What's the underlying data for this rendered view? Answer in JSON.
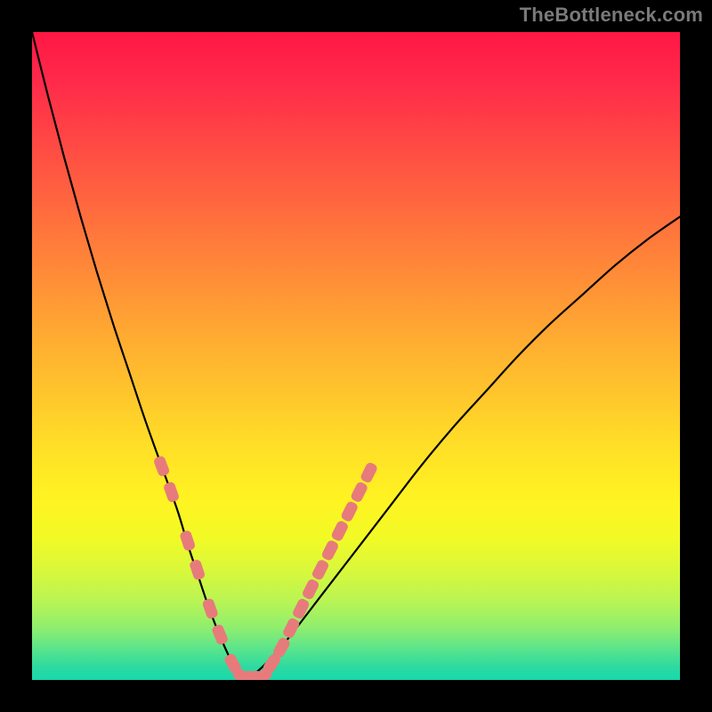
{
  "watermark": "TheBottleneck.com",
  "chart_data": {
    "type": "line",
    "title": "",
    "xlabel": "",
    "ylabel": "",
    "xlim": [
      0,
      100
    ],
    "ylim": [
      0,
      100
    ],
    "grid": false,
    "gradient_bands": [
      {
        "pos": 0,
        "color": "#ff1744",
        "meaning": "severe-bottleneck"
      },
      {
        "pos": 50,
        "color": "#ffd027",
        "meaning": "moderate"
      },
      {
        "pos": 100,
        "color": "#17d8ac",
        "meaning": "balanced"
      }
    ],
    "series": [
      {
        "name": "left-branch",
        "x": [
          0.0,
          2.5,
          5.0,
          7.5,
          10.0,
          12.5,
          15.0,
          17.5,
          20.0,
          22.5,
          24.0,
          25.5,
          27.0,
          28.5,
          30.0,
          31.0,
          32.0,
          33.0
        ],
        "y": [
          100.0,
          90.0,
          80.5,
          71.5,
          63.0,
          55.0,
          47.5,
          40.0,
          33.0,
          26.0,
          21.0,
          16.5,
          12.0,
          8.0,
          4.5,
          2.5,
          1.0,
          0.0
        ]
      },
      {
        "name": "right-branch",
        "x": [
          33.0,
          35.0,
          37.5,
          40.0,
          45.0,
          50.0,
          55.0,
          60.0,
          65.0,
          70.0,
          75.0,
          80.0,
          85.0,
          90.0,
          95.0,
          100.0
        ],
        "y": [
          0.0,
          1.5,
          4.0,
          7.0,
          13.5,
          20.0,
          26.5,
          33.0,
          39.0,
          44.5,
          50.0,
          55.0,
          59.5,
          64.0,
          68.0,
          71.5
        ]
      }
    ],
    "markers": [
      {
        "name": "left-segment-markers",
        "shape": "rounded-rect",
        "color": "#e77b7b",
        "points": [
          {
            "x": 20.0,
            "y": 33.0
          },
          {
            "x": 21.5,
            "y": 29.0
          },
          {
            "x": 24.0,
            "y": 21.5
          },
          {
            "x": 25.5,
            "y": 17.0
          },
          {
            "x": 27.5,
            "y": 11.0
          },
          {
            "x": 29.0,
            "y": 7.0
          },
          {
            "x": 31.0,
            "y": 2.5
          },
          {
            "x": 32.5,
            "y": 0.5
          },
          {
            "x": 34.0,
            "y": 0.5
          },
          {
            "x": 35.5,
            "y": 0.5
          },
          {
            "x": 37.0,
            "y": 2.5
          },
          {
            "x": 38.5,
            "y": 5.0
          },
          {
            "x": 40.0,
            "y": 8.0
          },
          {
            "x": 41.5,
            "y": 11.0
          },
          {
            "x": 43.0,
            "y": 14.0
          },
          {
            "x": 44.5,
            "y": 17.0
          },
          {
            "x": 46.0,
            "y": 20.0
          },
          {
            "x": 47.5,
            "y": 23.0
          },
          {
            "x": 49.0,
            "y": 26.0
          },
          {
            "x": 50.5,
            "y": 29.0
          },
          {
            "x": 52.0,
            "y": 32.0
          }
        ]
      }
    ]
  }
}
